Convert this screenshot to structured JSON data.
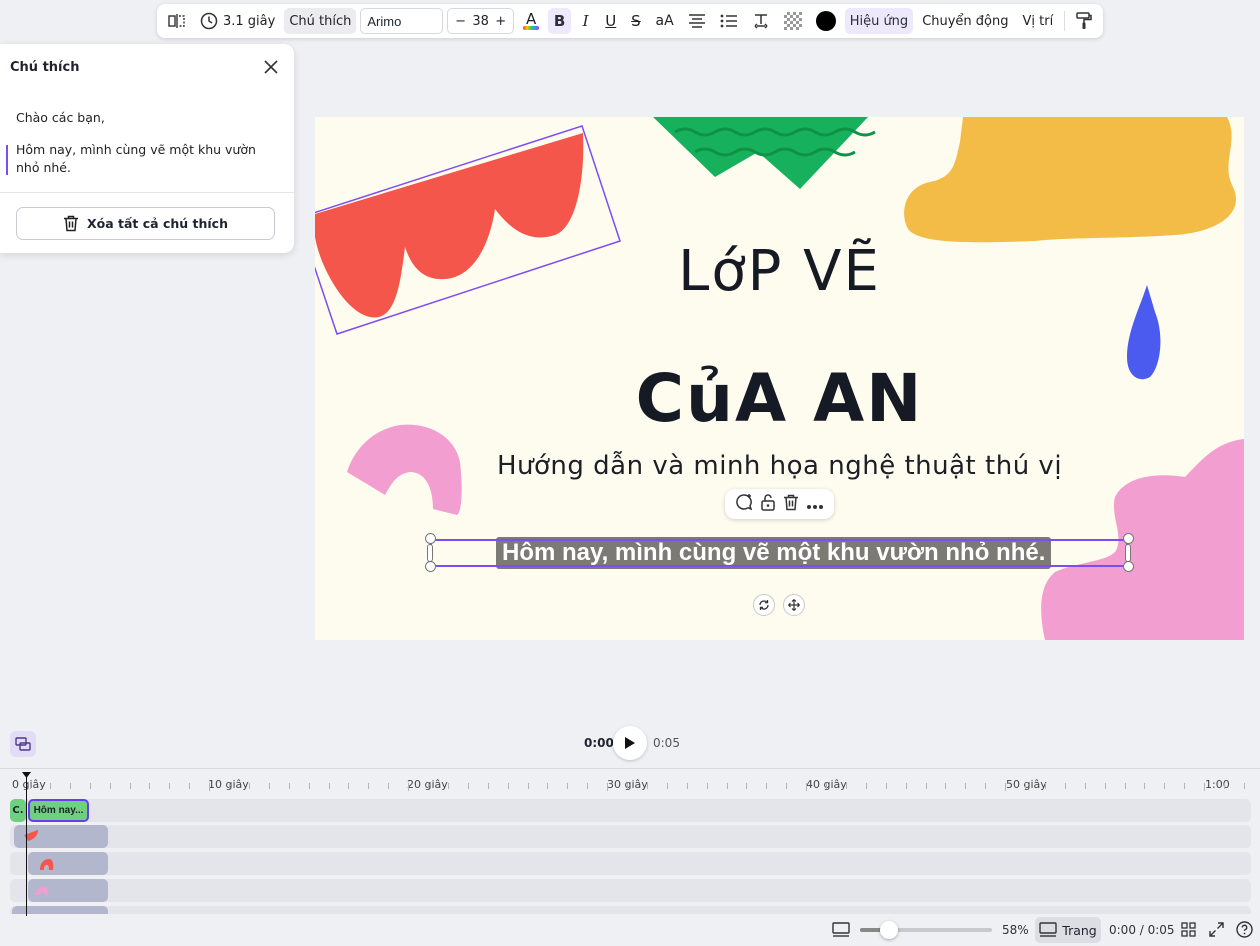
{
  "toolbar": {
    "duration": "3.1 giây",
    "caption_tab": "Chú thích",
    "font": "Arimo",
    "size_minus": "−",
    "font_size": "38",
    "size_plus": "+",
    "text_color_letter": "A",
    "bold": "B",
    "italic": "I",
    "underline": "U",
    "strike": "S",
    "case": "aA",
    "effects": "Hiệu ứng",
    "animation": "Chuyển động",
    "position": "Vị trí",
    "text_color": "#000000"
  },
  "panel": {
    "title": "Chú thích",
    "captions": [
      "Chào các bạn,",
      "Hôm nay, mình cùng vẽ một khu vườn",
      "nhỏ nhé."
    ],
    "delete_all": "Xóa tất cả chú thích"
  },
  "canvas": {
    "title_line1": "LớP VẼ",
    "title_line2": "CủA AN",
    "subtitle": "Hướng dẫn và minh họa nghệ thuật thú vị",
    "caption": "Hôm nay, mình cùng vẽ một khu vườn nhỏ nhé."
  },
  "playback": {
    "current": "0:00",
    "total": "0:05"
  },
  "timeline": {
    "ruler": [
      "0 giây",
      "10 giây",
      "20 giây",
      "30 giây",
      "40 giây",
      "50 giây",
      "1:00"
    ],
    "caption_track_label": "C.",
    "caption_clip": "Hôm nay..."
  },
  "bottom": {
    "zoom": "58%",
    "zoom_level": 0.58,
    "page": "Trang",
    "page_time": "0:00 / 0:05"
  },
  "colors": {
    "accent": "#7d4cf5",
    "red_shape": "#f4564b",
    "green_shape": "#17b15d",
    "yellow_shape": "#f2bc47",
    "pink_shape": "#f39ed0",
    "blue_shape": "#4b5bf0",
    "canvas_bg": "#fefcef"
  }
}
